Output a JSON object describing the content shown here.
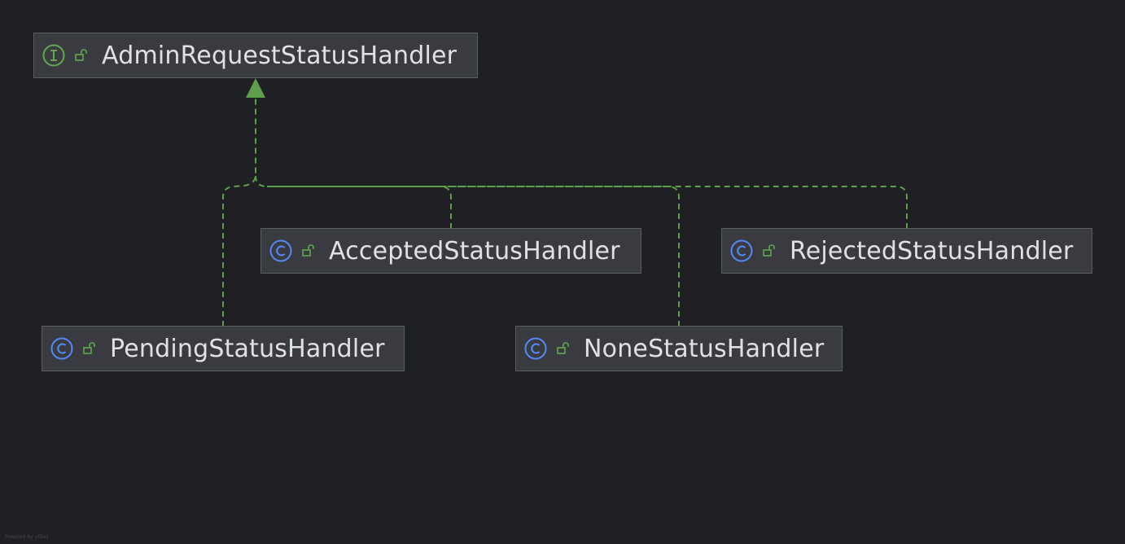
{
  "diagram": {
    "interface": {
      "name": "AdminRequestStatusHandler",
      "kind_icon": "interface-icon",
      "visibility_icon": "public-unlock-icon"
    },
    "classes": [
      {
        "name": "AcceptedStatusHandler",
        "kind_icon": "class-icon",
        "visibility_icon": "public-unlock-icon"
      },
      {
        "name": "RejectedStatusHandler",
        "kind_icon": "class-icon",
        "visibility_icon": "public-unlock-icon"
      },
      {
        "name": "PendingStatusHandler",
        "kind_icon": "class-icon",
        "visibility_icon": "public-unlock-icon"
      },
      {
        "name": "NoneStatusHandler",
        "kind_icon": "class-icon",
        "visibility_icon": "public-unlock-icon"
      }
    ],
    "relations": [
      {
        "from": "AcceptedStatusHandler",
        "to": "AdminRequestStatusHandler",
        "type": "implements"
      },
      {
        "from": "RejectedStatusHandler",
        "to": "AdminRequestStatusHandler",
        "type": "implements"
      },
      {
        "from": "PendingStatusHandler",
        "to": "AdminRequestStatusHandler",
        "type": "implements"
      },
      {
        "from": "NoneStatusHandler",
        "to": "AdminRequestStatusHandler",
        "type": "implements"
      }
    ]
  },
  "colors": {
    "background": "#1f2024",
    "node_fill": "#393b40",
    "node_border": "#5a5d63",
    "text": "#dfe1e5",
    "interface_icon": "#5fa84f",
    "class_icon": "#548af7",
    "visibility_icon": "#5fa84f",
    "edge": "#5e9e4c"
  },
  "footer": {
    "watermark": "Powered by yFiles"
  }
}
